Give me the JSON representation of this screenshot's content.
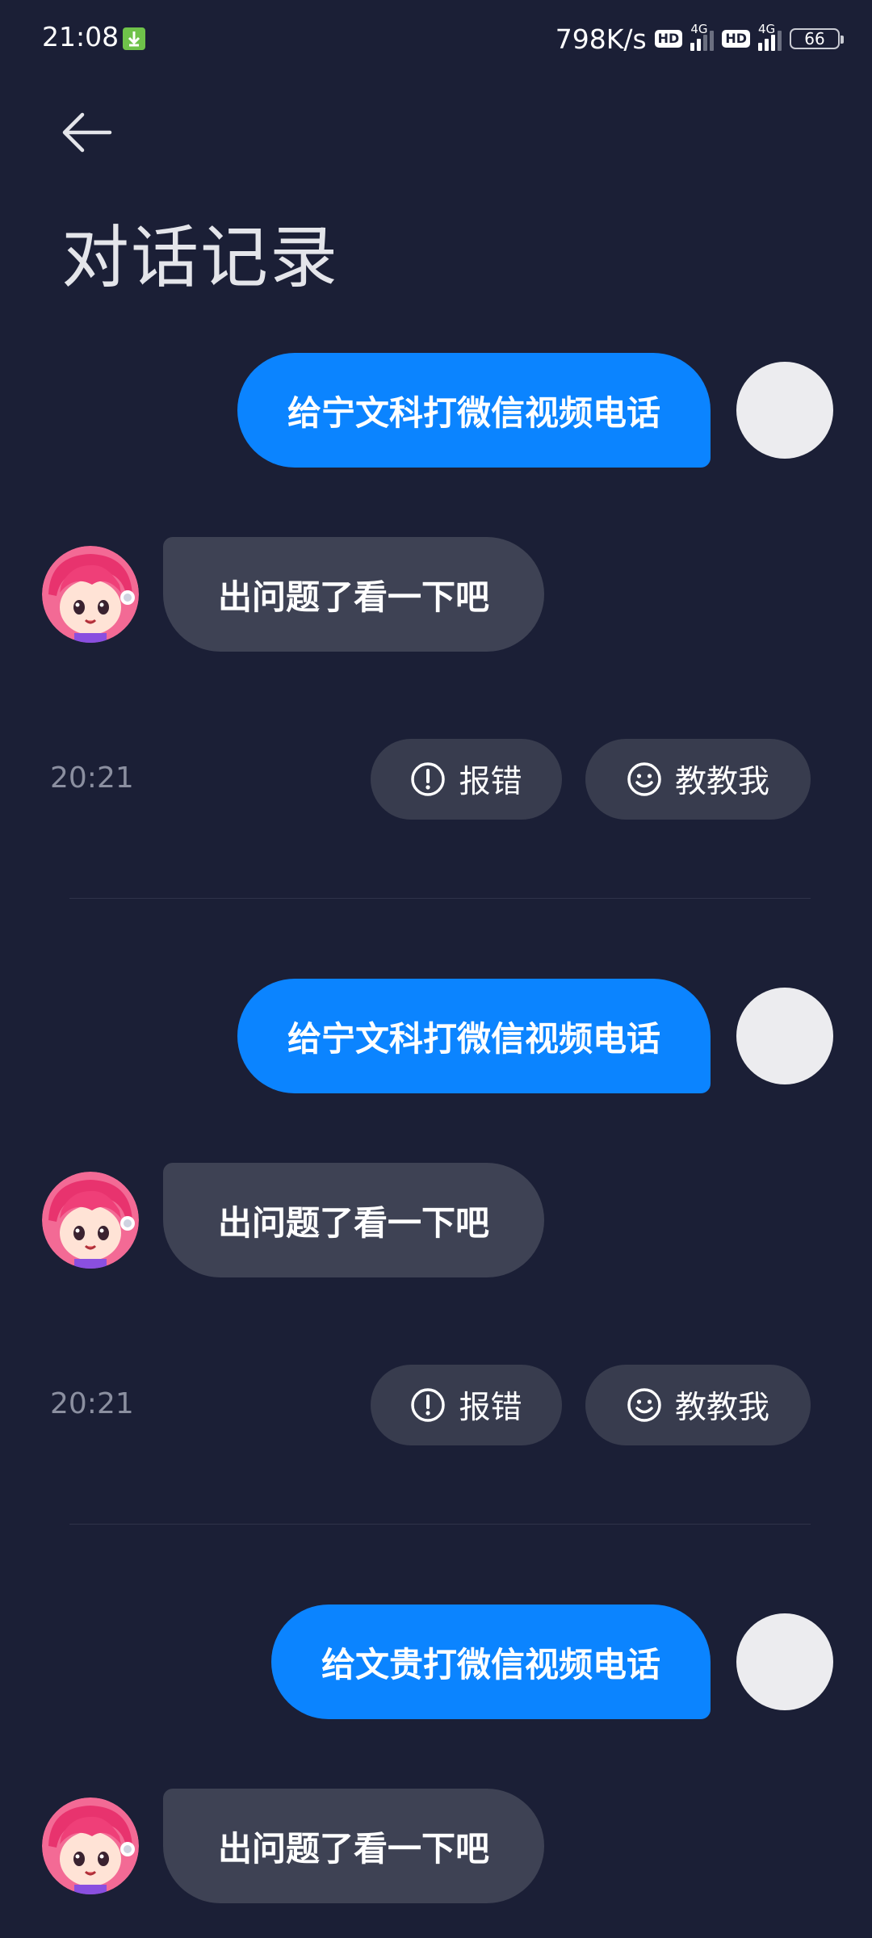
{
  "status_bar": {
    "time": "21:08",
    "net_speed": "798K/s",
    "hd_label": "HD",
    "network_gen": "4G",
    "battery": "66"
  },
  "header": {
    "title": "对话记录",
    "back_icon": "arrow-left-icon"
  },
  "conversations": [
    {
      "user_message": "给宁文科打微信视频电话",
      "bot_message": "出问题了看一下吧",
      "timestamp": "20:21",
      "report_label": "报错",
      "teach_label": "教教我"
    },
    {
      "user_message": "给宁文科打微信视频电话",
      "bot_message": "出问题了看一下吧",
      "timestamp": "20:21",
      "report_label": "报错",
      "teach_label": "教教我"
    },
    {
      "user_message": "给文贵打微信视频电话",
      "bot_message": "出问题了看一下吧"
    }
  ],
  "colors": {
    "background": "#1b1f36",
    "user_bubble": "#0b84ff",
    "bot_bubble": "#3e4254",
    "pill": "#383c4e"
  }
}
